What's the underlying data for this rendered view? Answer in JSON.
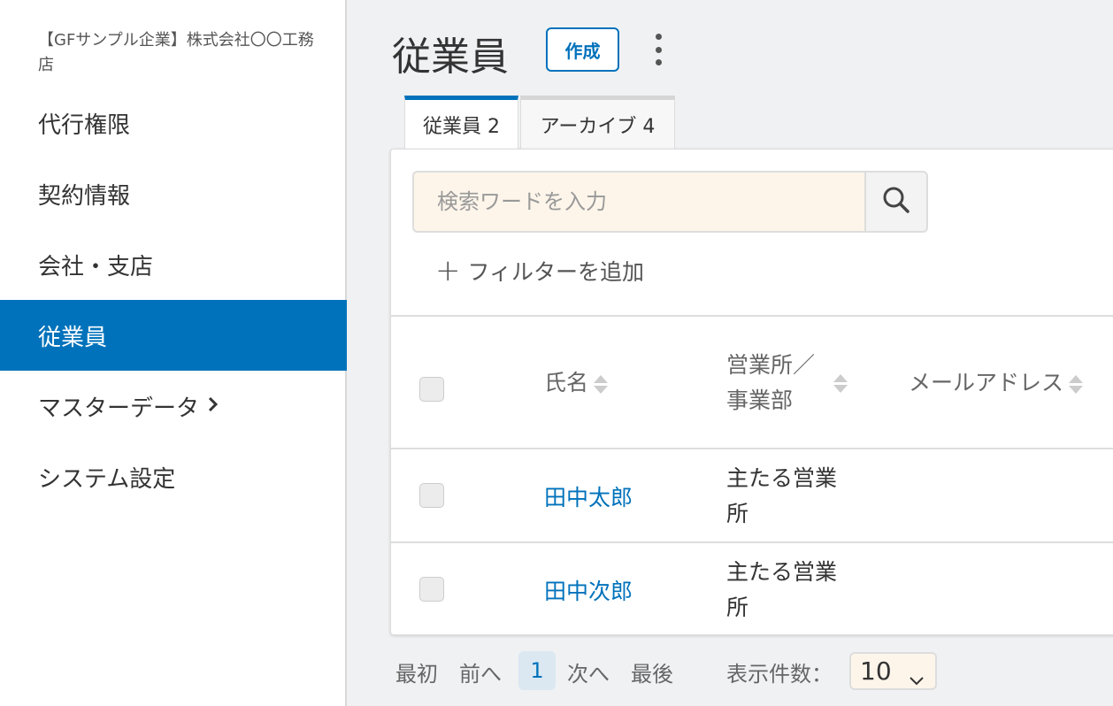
{
  "sidebar": {
    "company": "【GFサンプル企業】株式会社〇〇工務店",
    "items": [
      {
        "label": "代行権限"
      },
      {
        "label": "契約情報"
      },
      {
        "label": "会社・支店"
      },
      {
        "label": "従業員",
        "active": true
      },
      {
        "label": "マスターデータ"
      },
      {
        "label": "システム設定"
      }
    ]
  },
  "header": {
    "title": "従業員",
    "create_label": "作成"
  },
  "tabs": [
    {
      "label": "従業員 2",
      "active": true
    },
    {
      "label": "アーカイブ 4",
      "active": false
    }
  ],
  "search": {
    "placeholder": "検索ワードを入力",
    "value": ""
  },
  "filter": {
    "add_label": "フィルターを追加"
  },
  "table": {
    "columns": [
      "氏名",
      "営業所／事業部",
      "メールアドレス"
    ],
    "rows": [
      {
        "name": "田中太郎",
        "office": "主たる営業所",
        "email": ""
      },
      {
        "name": "田中次郎",
        "office": "主たる営業所",
        "email": ""
      }
    ]
  },
  "pagination": {
    "first": "最初",
    "prev": "前へ",
    "current": "1",
    "next": "次へ",
    "last": "最後",
    "per_page_label": "表示件数：",
    "per_page_value": "10"
  },
  "colors": {
    "accent": "#0072bb",
    "search_bg": "#fdf5ea"
  }
}
